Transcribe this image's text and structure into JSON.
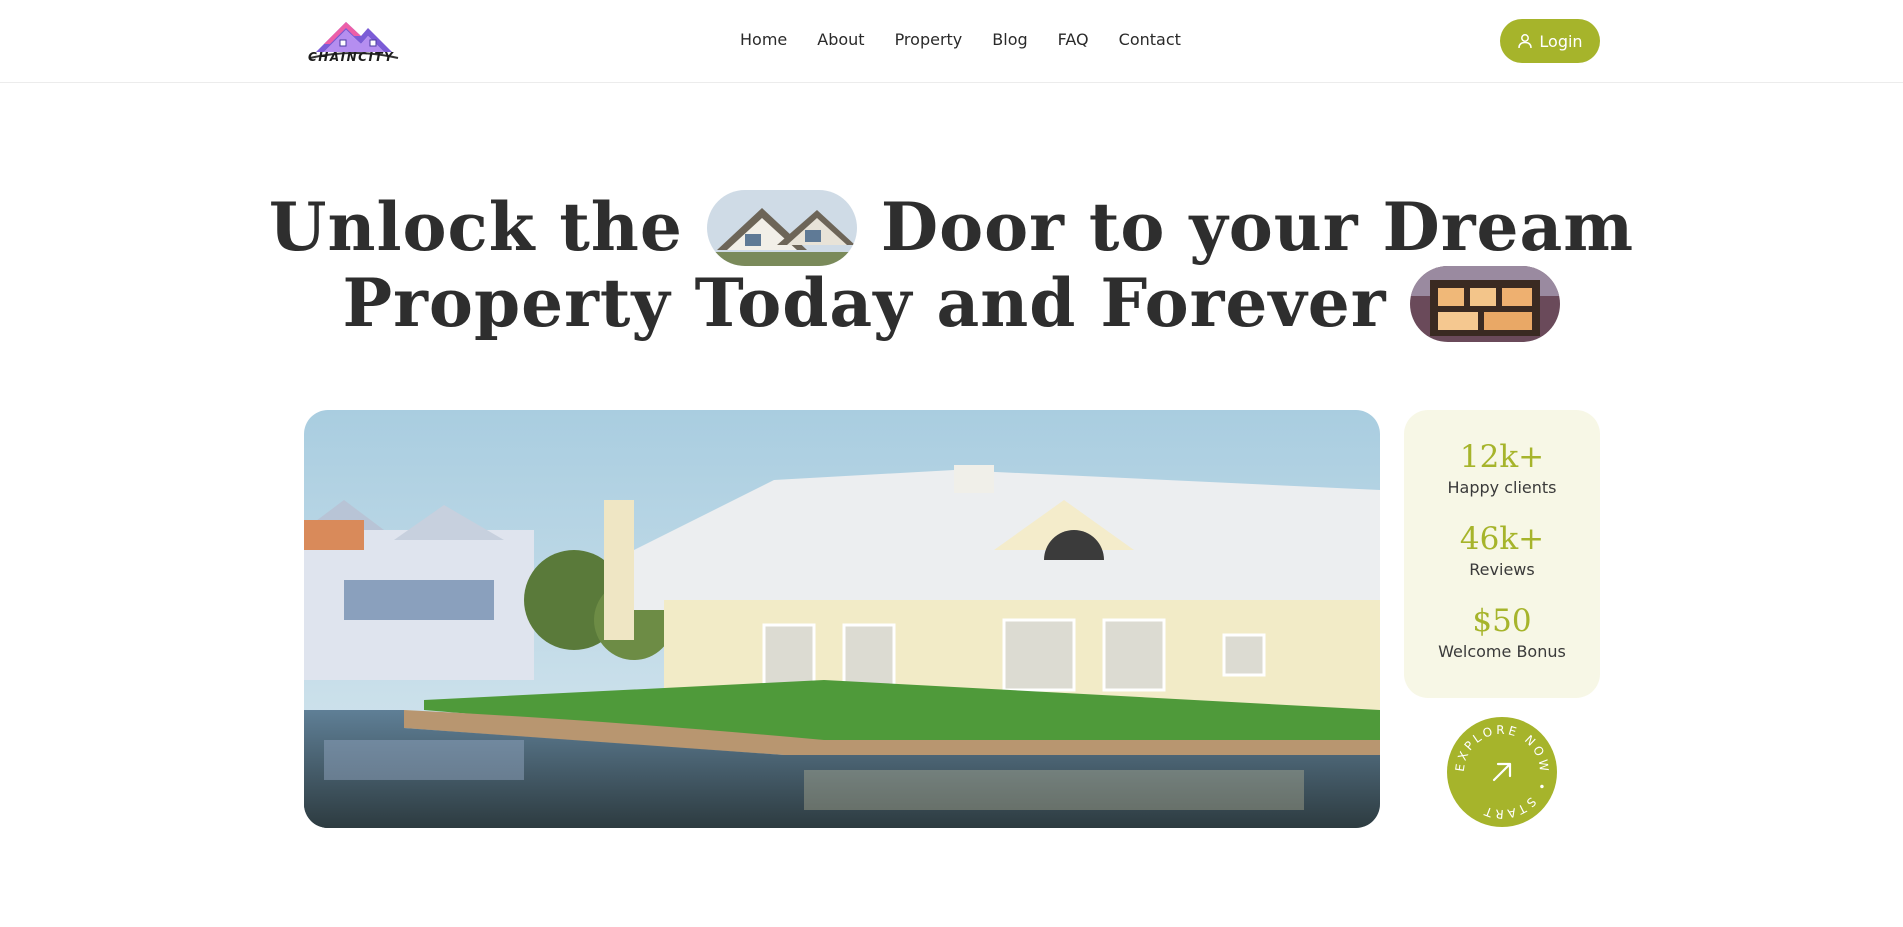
{
  "header": {
    "logo_text": "CHAINCITY",
    "nav": [
      "Home",
      "About",
      "Property",
      "Blog",
      "FAQ",
      "Contact"
    ],
    "login_label": "Login",
    "icons": {
      "login": "user-icon"
    }
  },
  "hero": {
    "line1_part1": "Unlock the",
    "line1_part2": "Door to your Dream",
    "line2": "Property Today and Forever"
  },
  "stats": [
    {
      "value": "12k+",
      "label": "Happy clients"
    },
    {
      "value": "46k+",
      "label": "Reviews"
    },
    {
      "value": "$50",
      "label": "Welcome Bonus"
    }
  ],
  "explore": {
    "ring_text": "EXPLORE NOW • START",
    "icon": "arrow-up-right-icon"
  },
  "colors": {
    "accent": "#a6b42b",
    "card_bg": "#f7f7e6",
    "text": "#2e2e2e"
  }
}
